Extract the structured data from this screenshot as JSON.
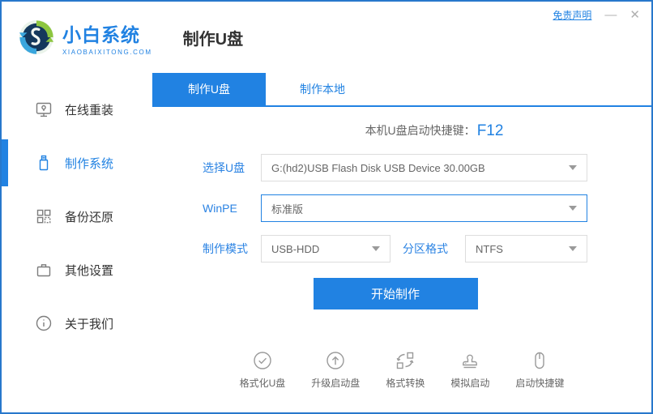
{
  "header": {
    "logo": {
      "brand": "小白系统",
      "domain": "XIAOBAIXITONG.COM",
      "icon": "swirl-globe-logo"
    },
    "title": "制作U盘",
    "disclaimer_link": "免责声明",
    "minimize_label": "—",
    "close_label": "✕"
  },
  "sidebar": {
    "items": [
      {
        "label": "在线重装",
        "icon": "monitor-icon",
        "active": false
      },
      {
        "label": "制作系统",
        "icon": "usb-drive-icon",
        "active": true
      },
      {
        "label": "备份还原",
        "icon": "backup-grid-icon",
        "active": false
      },
      {
        "label": "其他设置",
        "icon": "briefcase-icon",
        "active": false
      },
      {
        "label": "关于我们",
        "icon": "info-icon",
        "active": false
      }
    ]
  },
  "tabs": [
    {
      "label": "制作U盘",
      "active": true
    },
    {
      "label": "制作本地",
      "active": false
    }
  ],
  "main": {
    "hotkey_label": "本机U盘启动快捷键：",
    "hotkey_value": "F12",
    "fields": {
      "usb_select": {
        "label": "选择U盘",
        "value": "G:(hd2)USB Flash Disk USB Device 30.00GB"
      },
      "winpe_select": {
        "label": "WinPE",
        "value": "标准版"
      },
      "mode_select": {
        "label": "制作模式",
        "value": "USB-HDD"
      },
      "partition_select": {
        "label": "分区格式",
        "value": "NTFS"
      }
    },
    "start_button": "开始制作"
  },
  "footer": {
    "tools": [
      {
        "label": "格式化U盘",
        "icon": "check-circle-icon"
      },
      {
        "label": "升级启动盘",
        "icon": "arrow-up-circle-icon"
      },
      {
        "label": "格式转换",
        "icon": "convert-icon"
      },
      {
        "label": "模拟启动",
        "icon": "stamp-icon"
      },
      {
        "label": "启动快捷键",
        "icon": "mouse-icon"
      }
    ]
  },
  "colors": {
    "primary_blue": "#2182e2",
    "window_border": "#2878cc",
    "icon_gray": "#9a9a9a"
  }
}
